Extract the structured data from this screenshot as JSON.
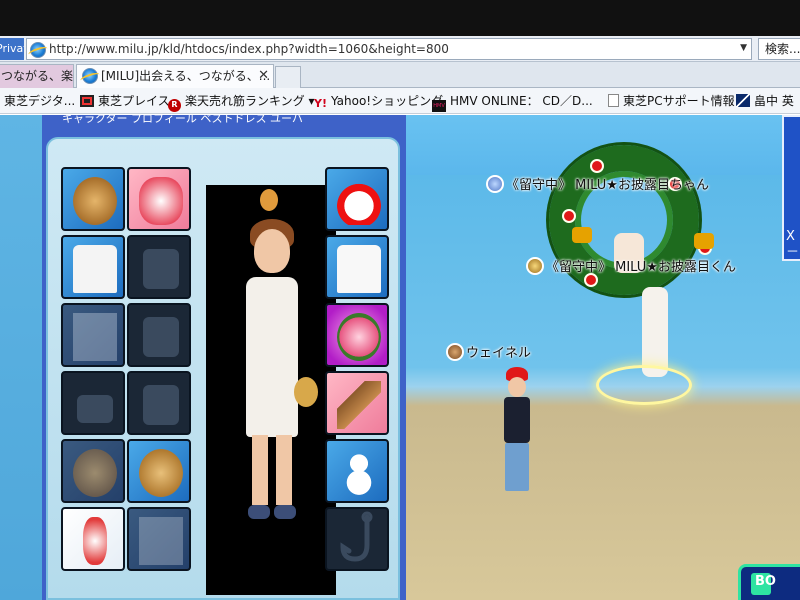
{
  "browser": {
    "private_label": "Private",
    "address": "http://www.milu.jp/kld/htdocs/index.php?width=1060&height=800",
    "search_label": "検索...",
    "tabs": [
      {
        "label": "つながる、楽し..."
      },
      {
        "label": "[MILU]出会える、つながる、...",
        "close": "✕"
      }
    ],
    "favorites": [
      {
        "label": "東芝デジタ...",
        "icon": "page-icon"
      },
      {
        "label": "東芝プレイス",
        "icon": "toshiba-icon"
      },
      {
        "label": "楽天売れ筋ランキング",
        "icon": "rakuten-icon",
        "dropdown": "▾"
      },
      {
        "label": "Yahoo!ショッピング",
        "icon": "yahoo-icon"
      },
      {
        "label": "HMV ONLINE： CD／D...",
        "icon": "hmv-icon"
      },
      {
        "label": "東芝PCサポート情報",
        "icon": "page-icon"
      },
      {
        "label": "畠中 英",
        "icon": "ms-icon"
      }
    ]
  },
  "game": {
    "players": [
      {
        "label": "《留守中》 MILU★お披露目ちゃん",
        "badge": "blue"
      },
      {
        "label": "《留守中》 MILU★お披露目くん",
        "badge": "gold"
      },
      {
        "label": "ウェイネル",
        "badge": "brown"
      }
    ],
    "side_sign_text": "X－",
    "bottom_button": "BO"
  },
  "panel": {
    "header_text": "キャラクター プロフィール ベストドレス ユーバ"
  },
  "colors": {
    "panel_blue": "#3e62c8",
    "sky": "#63b9e6",
    "accent_green": "#2ee3a2"
  }
}
